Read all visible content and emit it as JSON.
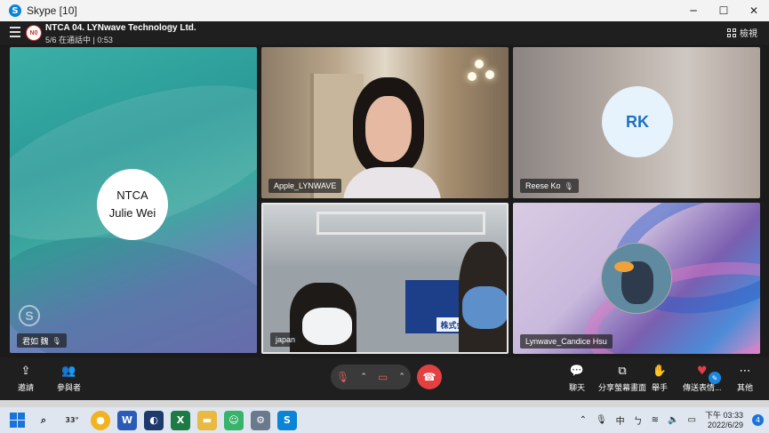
{
  "window": {
    "title": "Skype [10]",
    "min_icon": "minimize-icon",
    "max_icon": "maximize-icon",
    "close_icon": "close-icon"
  },
  "call": {
    "avatar_initials": "N0",
    "title": "NTCA 04. LYNwave Technology Ltd.",
    "subtitle": "5/6 在通話中 | 0:53",
    "view_label": "檢視"
  },
  "participants": {
    "julie": {
      "bubble_line1": "NTCA",
      "bubble_line2": "Julie Wei",
      "label": "君如 魏"
    },
    "apple": {
      "label": "Apple_LYNWAVE"
    },
    "reese": {
      "initials": "RK",
      "label": "Reese Ko"
    },
    "japan": {
      "label": "japan",
      "sign": "株式会社"
    },
    "candice": {
      "label": "Lynwave_Candice Hsu"
    }
  },
  "controls": {
    "invite": "邀請",
    "participants": "參與者",
    "chat": "聊天",
    "share": "分享螢幕畫面",
    "raise_hand": "舉手",
    "react": "傳送表情...",
    "more": "其他"
  },
  "taskbar": {
    "weather_temp": "33°",
    "ime": "中",
    "time": "下午 03:33",
    "date": "2022/6/29",
    "notifications": "4"
  },
  "colors": {
    "accent": "#0a84d6",
    "hangup": "#e34141",
    "heart": "#e33d4a"
  }
}
